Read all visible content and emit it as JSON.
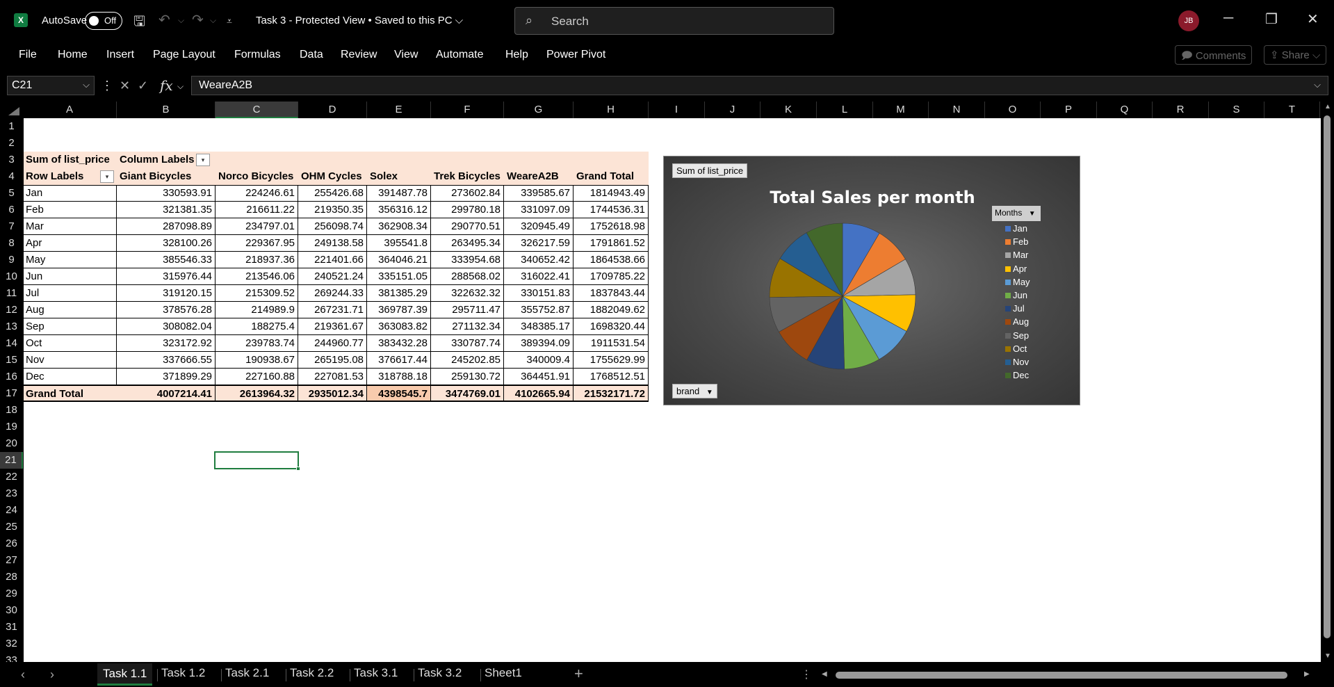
{
  "titlebar": {
    "app_logo": "X",
    "autosave_label": "AutoSave",
    "autosave_state": "Off",
    "doc_title": "Task 3  -  Protected View • Saved to this PC ⌵",
    "search_placeholder": "Search",
    "user_initials": "JB"
  },
  "menu": {
    "items": [
      "File",
      "Home",
      "Insert",
      "Page Layout",
      "Formulas",
      "Data",
      "Review",
      "View",
      "Automate",
      "Help",
      "Power Pivot"
    ],
    "comments_label": "Comments",
    "share_label": "Share"
  },
  "formula_bar": {
    "name_box": "C21",
    "formula": "WeareA2B"
  },
  "columns": [
    "A",
    "B",
    "C",
    "D",
    "E",
    "F",
    "G",
    "H",
    "I",
    "J",
    "K",
    "L",
    "M",
    "N",
    "O",
    "P",
    "Q",
    "R",
    "S",
    "T"
  ],
  "rows": [
    "1",
    "2",
    "3",
    "4",
    "5",
    "6",
    "7",
    "8",
    "9",
    "10",
    "11",
    "12",
    "13",
    "14",
    "15",
    "16",
    "17",
    "18",
    "19",
    "20",
    "21",
    "22",
    "23",
    "24",
    "25",
    "26",
    "27",
    "28",
    "29",
    "30",
    "31",
    "32",
    "33"
  ],
  "pivot": {
    "values_label": "Sum of list_price",
    "column_labels": "Column Labels",
    "row_labels": "Row Labels",
    "headers": [
      "Giant Bicycles",
      "Norco Bicycles",
      "OHM Cycles",
      "Solex",
      "Trek Bicycles",
      "WeareA2B",
      "Grand Total"
    ],
    "rows": [
      {
        "label": "Jan",
        "values": [
          "330593.91",
          "224246.61",
          "255426.68",
          "391487.78",
          "273602.84",
          "339585.67",
          "1814943.49"
        ]
      },
      {
        "label": "Feb",
        "values": [
          "321381.35",
          "216611.22",
          "219350.35",
          "356316.12",
          "299780.18",
          "331097.09",
          "1744536.31"
        ]
      },
      {
        "label": "Mar",
        "values": [
          "287098.89",
          "234797.01",
          "256098.74",
          "362908.34",
          "290770.51",
          "320945.49",
          "1752618.98"
        ]
      },
      {
        "label": "Apr",
        "values": [
          "328100.26",
          "229367.95",
          "249138.58",
          "395541.8",
          "263495.34",
          "326217.59",
          "1791861.52"
        ]
      },
      {
        "label": "May",
        "values": [
          "385546.33",
          "218937.36",
          "221401.66",
          "364046.21",
          "333954.68",
          "340652.42",
          "1864538.66"
        ]
      },
      {
        "label": "Jun",
        "values": [
          "315976.44",
          "213546.06",
          "240521.24",
          "335151.05",
          "288568.02",
          "316022.41",
          "1709785.22"
        ]
      },
      {
        "label": "Jul",
        "values": [
          "319120.15",
          "215309.52",
          "269244.33",
          "381385.29",
          "322632.32",
          "330151.83",
          "1837843.44"
        ]
      },
      {
        "label": "Aug",
        "values": [
          "378576.28",
          "214989.9",
          "267231.71",
          "369787.39",
          "295711.47",
          "355752.87",
          "1882049.62"
        ]
      },
      {
        "label": "Sep",
        "values": [
          "308082.04",
          "188275.4",
          "219361.67",
          "363083.82",
          "271132.34",
          "348385.17",
          "1698320.44"
        ]
      },
      {
        "label": "Oct",
        "values": [
          "323172.92",
          "239783.74",
          "244960.77",
          "383432.28",
          "330787.74",
          "389394.09",
          "1911531.54"
        ]
      },
      {
        "label": "Nov",
        "values": [
          "337666.55",
          "190938.67",
          "265195.08",
          "376617.44",
          "245202.85",
          "340009.4",
          "1755629.99"
        ]
      },
      {
        "label": "Dec",
        "values": [
          "371899.29",
          "227160.88",
          "227081.53",
          "318788.18",
          "259130.72",
          "364451.91",
          "1768512.51"
        ]
      }
    ],
    "grand_total_label": "Grand Total",
    "grand_totals": [
      "4007214.41",
      "2613964.32",
      "2935012.34",
      "4398545.7",
      "3474769.01",
      "4102665.94",
      "21532171.72"
    ]
  },
  "chart_data": {
    "type": "pie",
    "title": "Total Sales per month",
    "field_button_values": "Sum of list_price",
    "field_button_axis": "brand",
    "legend_title": "Months",
    "legend_position": "right",
    "categories": [
      "Jan",
      "Feb",
      "Mar",
      "Apr",
      "May",
      "Jun",
      "Jul",
      "Aug",
      "Sep",
      "Oct",
      "Nov",
      "Dec"
    ],
    "values": [
      1814943.49,
      1744536.31,
      1752618.98,
      1791861.52,
      1864538.66,
      1709785.22,
      1837843.44,
      1882049.62,
      1698320.44,
      1911531.54,
      1755629.99,
      1768512.51
    ],
    "colors": [
      "#4472c4",
      "#ed7d31",
      "#a5a5a5",
      "#ffc000",
      "#5b9bd5",
      "#70ad47",
      "#264478",
      "#9e480e",
      "#636363",
      "#997300",
      "#255e91",
      "#43682b"
    ]
  },
  "sheet_tabs": {
    "tabs": [
      "Task 1.1",
      "Task 1.2",
      "Task 2.1",
      "Task 2.2",
      "Task 3.1",
      "Task 3.2",
      "Sheet1"
    ],
    "active": "Task 1.1"
  }
}
